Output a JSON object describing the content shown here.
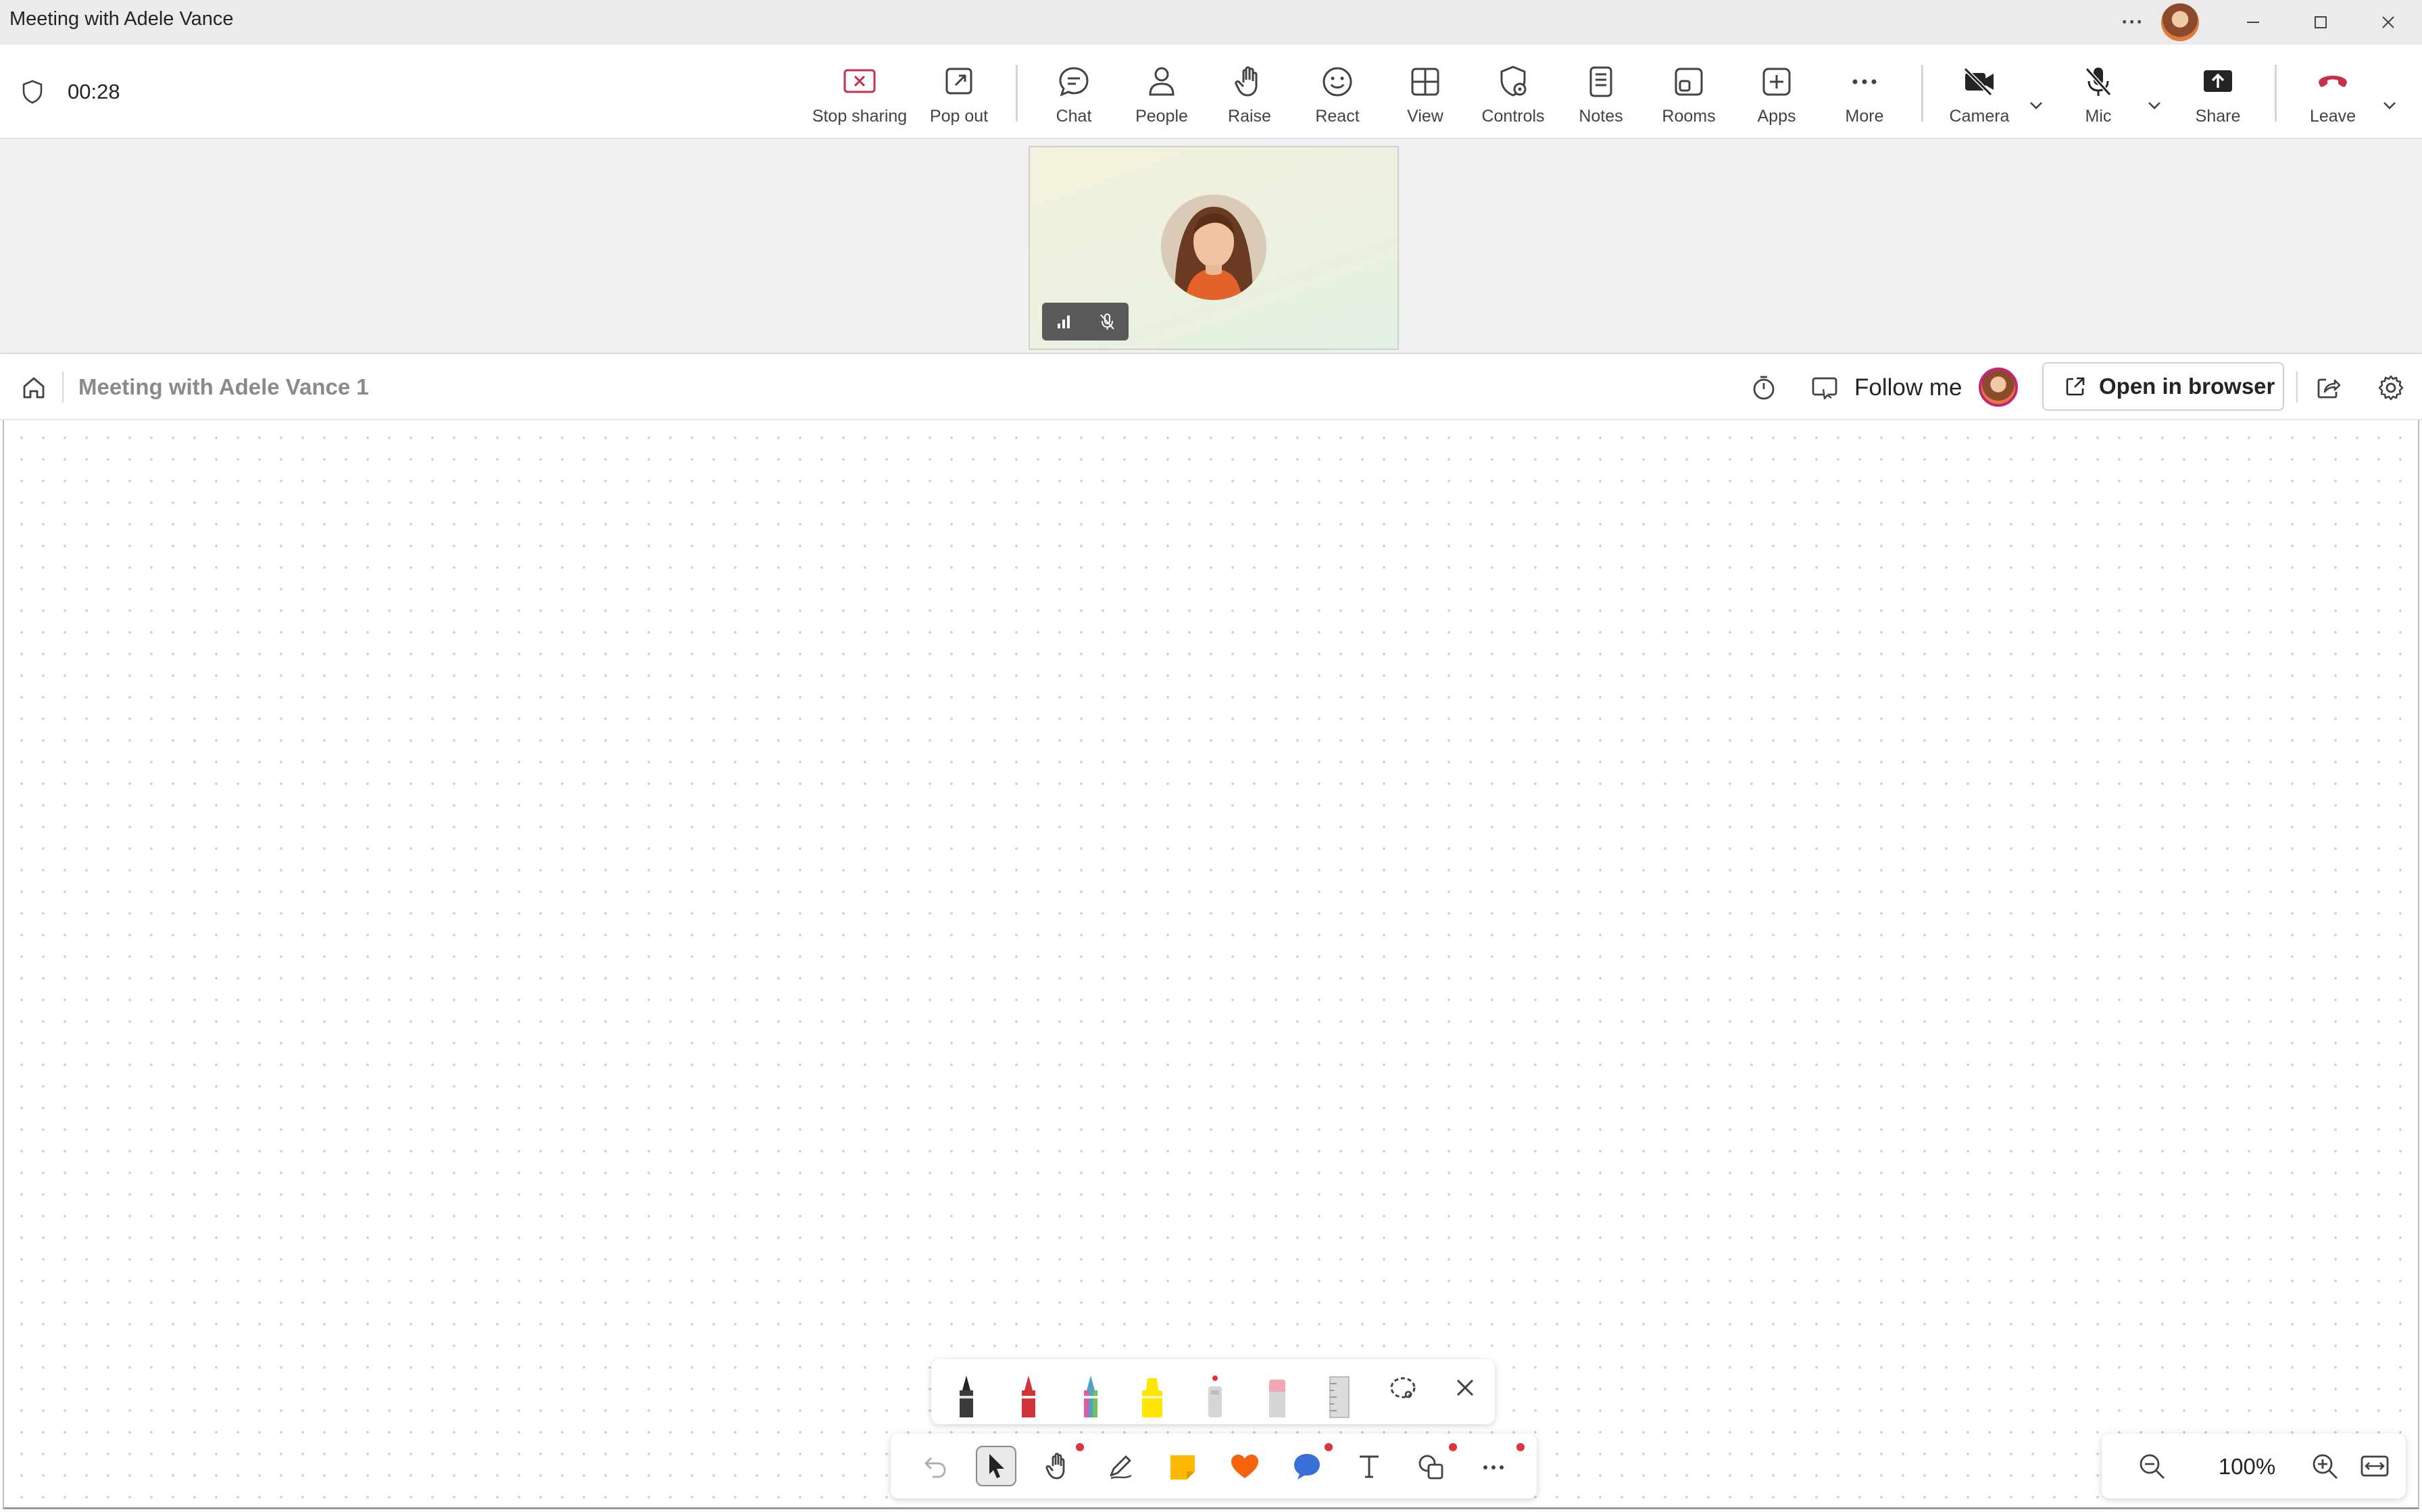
{
  "window": {
    "title": "Meeting with Adele Vance",
    "more_label": "···"
  },
  "meeting_bar": {
    "timer": "00:28",
    "tools": [
      {
        "label": "Stop sharing",
        "icon": "stop-sharing-icon"
      },
      {
        "label": "Pop out",
        "icon": "pop-out-icon"
      },
      {
        "label": "Chat",
        "icon": "chat-icon"
      },
      {
        "label": "People",
        "icon": "people-icon"
      },
      {
        "label": "Raise",
        "icon": "raise-hand-icon"
      },
      {
        "label": "React",
        "icon": "react-icon"
      },
      {
        "label": "View",
        "icon": "view-icon"
      },
      {
        "label": "Controls",
        "icon": "controls-icon"
      },
      {
        "label": "Notes",
        "icon": "notes-icon"
      },
      {
        "label": "Rooms",
        "icon": "rooms-icon"
      },
      {
        "label": "Apps",
        "icon": "apps-icon"
      },
      {
        "label": "More",
        "icon": "more-icon"
      },
      {
        "label": "Camera",
        "icon": "camera-off-icon"
      },
      {
        "label": "Mic",
        "icon": "mic-off-icon"
      },
      {
        "label": "Share",
        "icon": "share-icon"
      },
      {
        "label": "Leave",
        "icon": "leave-icon"
      }
    ]
  },
  "whiteboard": {
    "title": "Meeting with Adele Vance 1",
    "follow_me": "Follow me",
    "open_in_browser": "Open in browser",
    "zoom": "100%"
  },
  "colors": {
    "stop_sharing": "#c4314b",
    "leave": "#c4314b",
    "accent_dot": "#e0333a",
    "pen_black": "#242424",
    "pen_red": "#d13438",
    "pen_rainbow": "#4aa3c8",
    "highlighter": "#ffe600",
    "sticky_note": "#ffb900",
    "heart": "#f7630c",
    "comment": "#3a6fd8"
  }
}
